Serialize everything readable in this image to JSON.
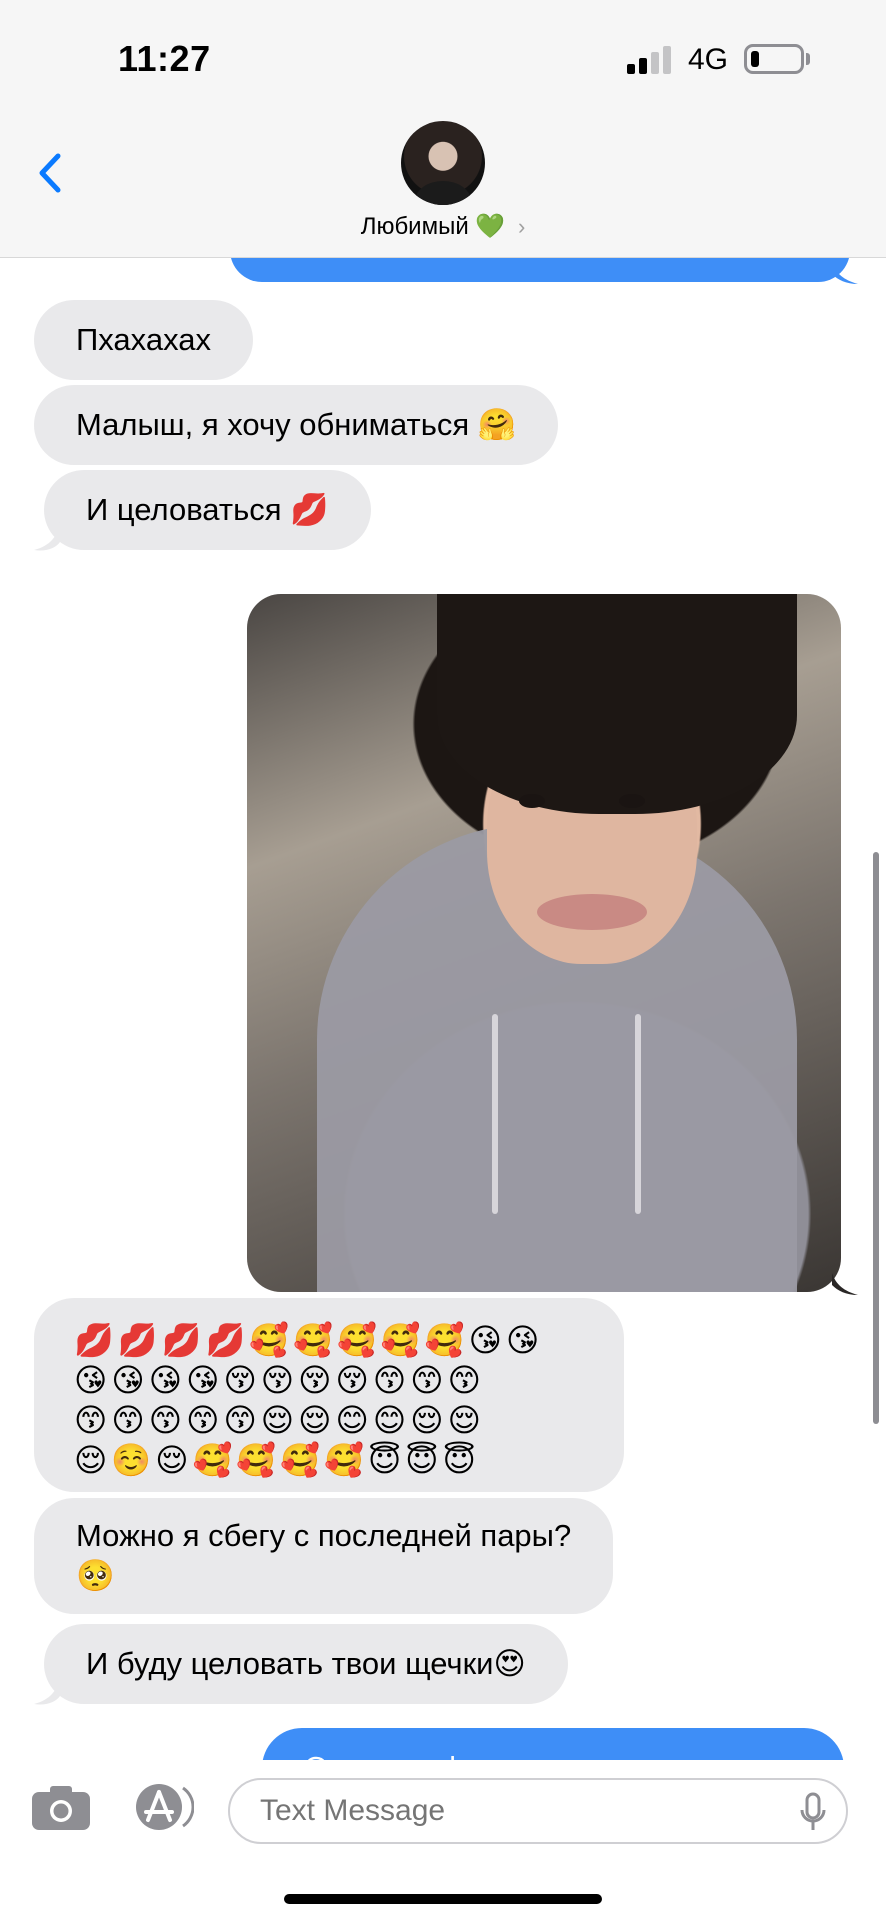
{
  "status_bar": {
    "time": "11:27",
    "network": "4G"
  },
  "header": {
    "contact_name": "Любимый",
    "name_emoji": "💚",
    "chevron": "›"
  },
  "messages": {
    "m1": "Пхахахах",
    "m2": "Малыш, я хочу обниматься 🤗",
    "m3": "И целоваться 💋",
    "emoji_rows": [
      "💋💋💋💋🥰🥰🥰🥰🥰😘😘",
      "😘😘😘😘😚😚😚😚😙😙😙",
      "😙😙😙😙😙😌😌😊😊😌😌",
      "😌☺️😌🥰🥰🥰🥰😇😇😇"
    ],
    "m5_line1": "Можно я сбегу с последней пары?",
    "m5_line2": "🥺",
    "m6": "И буду целовать твои щечки😍",
    "m7_partial": "От твоих фоточек у меня"
  },
  "input": {
    "placeholder": "Text Message"
  },
  "colors": {
    "outgoing_bubble": "#3e8ef7",
    "incoming_bubble": "#e9e9eb",
    "accent": "#0a7aff"
  }
}
